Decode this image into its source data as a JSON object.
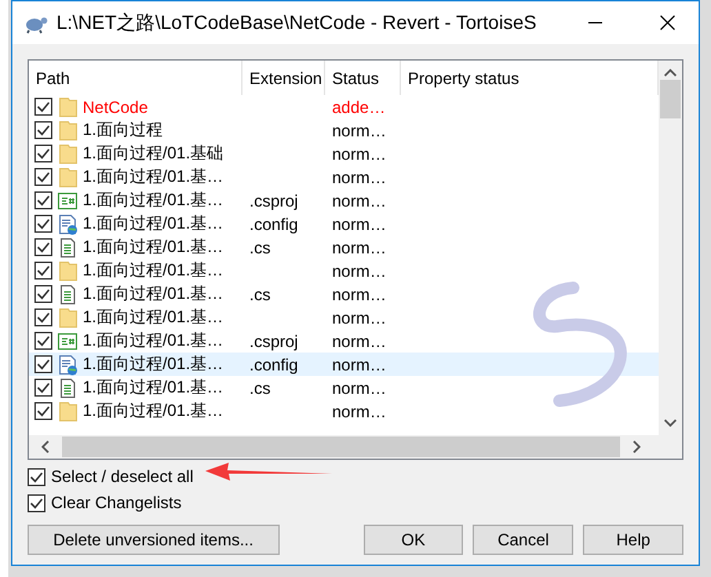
{
  "window": {
    "title": "L:\\NET之路\\LoTCodeBase\\NetCode - Revert - TortoiseS"
  },
  "list": {
    "columns": [
      "Path",
      "Extension",
      "Status",
      "Property status"
    ],
    "rows": [
      {
        "kind": "folder",
        "checked": true,
        "selected": false,
        "color": "#ff0000",
        "path": "NetCode",
        "status": "adde…"
      },
      {
        "kind": "folder",
        "checked": true,
        "selected": false,
        "color": "#000000",
        "path": "1.面向过程",
        "status": "norm…"
      },
      {
        "kind": "folder",
        "checked": true,
        "selected": false,
        "color": "#000000",
        "path": "1.面向过程/01.基础",
        "status": "norm…"
      },
      {
        "kind": "folder",
        "checked": true,
        "selected": false,
        "color": "#000000",
        "path": "1.面向过程/01.基…",
        "status": "norm…"
      },
      {
        "kind": "csharp",
        "checked": true,
        "selected": false,
        "color": "#000000",
        "path": "1.面向过程/01.基…",
        "extension": ".csproj",
        "status": "norm…"
      },
      {
        "kind": "config",
        "checked": true,
        "selected": false,
        "color": "#000000",
        "path": "1.面向过程/01.基…",
        "extension": ".config",
        "status": "norm…"
      },
      {
        "kind": "file",
        "checked": true,
        "selected": false,
        "color": "#000000",
        "path": "1.面向过程/01.基…",
        "extension": ".cs",
        "status": "norm…"
      },
      {
        "kind": "folder",
        "checked": true,
        "selected": false,
        "color": "#000000",
        "path": "1.面向过程/01.基…",
        "status": "norm…"
      },
      {
        "kind": "file",
        "checked": true,
        "selected": false,
        "color": "#000000",
        "path": "1.面向过程/01.基…",
        "extension": ".cs",
        "status": "norm…"
      },
      {
        "kind": "folder",
        "checked": true,
        "selected": false,
        "color": "#000000",
        "path": "1.面向过程/01.基…",
        "status": "norm…"
      },
      {
        "kind": "csharp",
        "checked": true,
        "selected": false,
        "color": "#000000",
        "path": "1.面向过程/01.基…",
        "extension": ".csproj",
        "status": "norm…"
      },
      {
        "kind": "config",
        "checked": true,
        "selected": true,
        "color": "#000000",
        "path": "1.面向过程/01.基…",
        "extension": ".config",
        "status": "norm…"
      },
      {
        "kind": "file",
        "checked": true,
        "selected": false,
        "color": "#000000",
        "path": "1.面向过程/01.基…",
        "extension": ".cs",
        "status": "norm…"
      },
      {
        "kind": "folder",
        "checked": true,
        "selected": false,
        "color": "#000000",
        "path": "1.面向过程/01.基…",
        "status": "norm…"
      }
    ]
  },
  "options": [
    {
      "label": "Select / deselect all",
      "checked": true
    },
    {
      "label": "Clear Changelists",
      "checked": true
    }
  ],
  "annotation": {
    "kind": "arrow"
  },
  "buttons": [
    "Delete unversioned items...",
    "OK",
    "Cancel",
    "Help"
  ]
}
